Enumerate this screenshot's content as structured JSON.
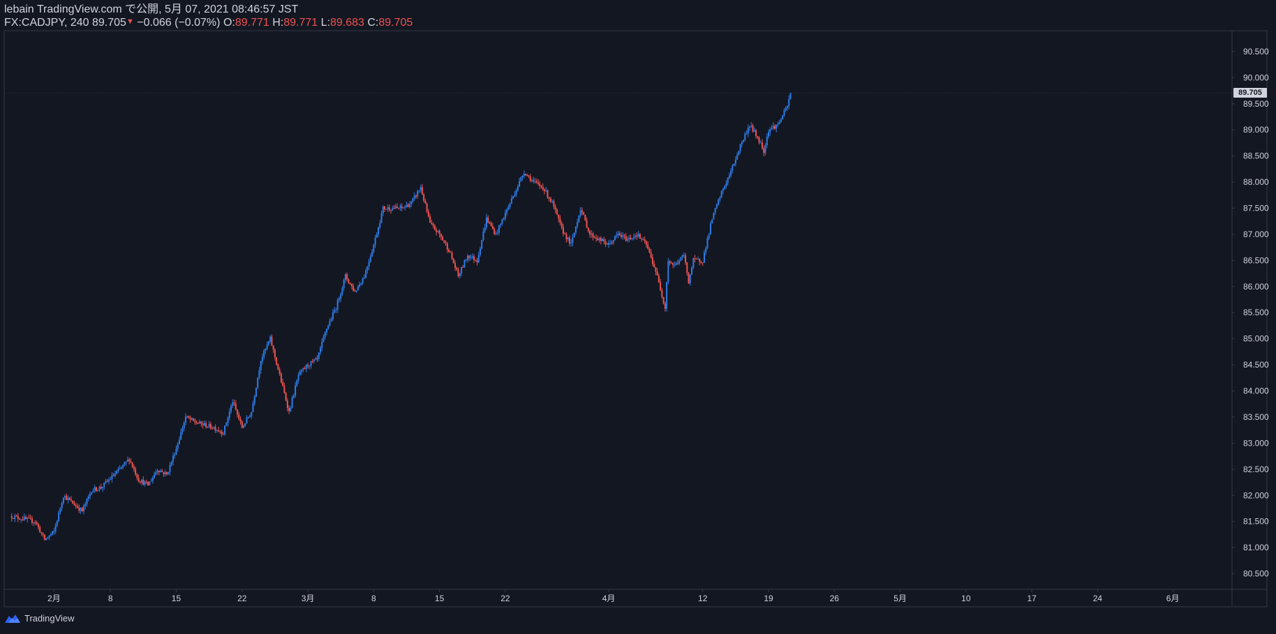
{
  "header": {
    "publish_line": "lebain TradingView.com で公開, 5月 07, 2021 08:46:57 JST",
    "symbol": "FX:CADJPY, 240",
    "last": "89.705",
    "arrow": "▼",
    "change": "−0.066 (−0.07%)",
    "o_label": "O:",
    "o_value": "89.771",
    "h_label": "H:",
    "h_value": "89.771",
    "l_label": "L:",
    "l_value": "89.683",
    "c_label": "C:",
    "c_value": "89.705"
  },
  "last_price_label": "89.705",
  "footer": {
    "brand": "TradingView",
    "logo_icon": "tradingview-logo-icon"
  },
  "colors": {
    "up": "#2f7ce8",
    "down": "#ef5350",
    "bg": "#131722",
    "border": "#363a45",
    "text": "#d1d4dc"
  },
  "chart_data": {
    "type": "candlestick",
    "instrument": "FX:CADJPY",
    "interval": "240",
    "ylim": [
      80.2,
      90.9
    ],
    "y_ticks": [
      "80.500",
      "81.000",
      "81.500",
      "82.000",
      "82.500",
      "83.000",
      "83.500",
      "84.000",
      "84.500",
      "85.000",
      "85.500",
      "86.000",
      "86.500",
      "87.000",
      "87.500",
      "88.000",
      "88.500",
      "89.000",
      "89.500",
      "90.000",
      "90.500"
    ],
    "x_ticks": [
      {
        "label": "2月",
        "day": 2
      },
      {
        "label": "8",
        "day": 8
      },
      {
        "label": "15",
        "day": 15
      },
      {
        "label": "22",
        "day": 22
      },
      {
        "label": "3月",
        "day": 29
      },
      {
        "label": "8",
        "day": 36
      },
      {
        "label": "15",
        "day": 43
      },
      {
        "label": "22",
        "day": 50
      },
      {
        "label": "4月",
        "day": 61
      },
      {
        "label": "12",
        "day": 71
      },
      {
        "label": "19",
        "day": 78
      },
      {
        "label": "26",
        "day": 85
      },
      {
        "label": "5月",
        "day": 92
      },
      {
        "label": "10",
        "day": 99
      },
      {
        "label": "17",
        "day": 106
      },
      {
        "label": "24",
        "day": 113
      },
      {
        "label": "6月",
        "day": 121
      }
    ],
    "path": [
      [
        -2.5,
        81.6
      ],
      [
        0,
        81.5
      ],
      [
        1,
        81.15
      ],
      [
        2,
        81.3
      ],
      [
        3,
        82.0
      ],
      [
        5,
        81.7
      ],
      [
        6,
        82.1
      ],
      [
        7,
        82.15
      ],
      [
        9,
        82.5
      ],
      [
        10,
        82.7
      ],
      [
        11,
        82.3
      ],
      [
        12,
        82.2
      ],
      [
        13,
        82.5
      ],
      [
        14,
        82.4
      ],
      [
        15,
        82.9
      ],
      [
        16,
        83.5
      ],
      [
        17,
        83.4
      ],
      [
        19,
        83.3
      ],
      [
        20,
        83.2
      ],
      [
        21,
        83.8
      ],
      [
        22,
        83.3
      ],
      [
        23,
        83.6
      ],
      [
        24,
        84.6
      ],
      [
        25,
        85.0
      ],
      [
        26,
        84.3
      ],
      [
        27,
        83.6
      ],
      [
        28,
        84.3
      ],
      [
        29,
        84.5
      ],
      [
        30,
        84.6
      ],
      [
        31,
        85.2
      ],
      [
        32,
        85.6
      ],
      [
        33,
        86.2
      ],
      [
        34,
        85.9
      ],
      [
        35,
        86.2
      ],
      [
        36,
        86.8
      ],
      [
        37,
        87.5
      ],
      [
        39,
        87.5
      ],
      [
        40,
        87.6
      ],
      [
        41,
        87.9
      ],
      [
        42,
        87.2
      ],
      [
        43,
        87.0
      ],
      [
        44,
        86.7
      ],
      [
        45,
        86.2
      ],
      [
        46,
        86.6
      ],
      [
        47,
        86.5
      ],
      [
        48,
        87.3
      ],
      [
        49,
        87.0
      ],
      [
        50,
        87.4
      ],
      [
        51,
        87.8
      ],
      [
        52,
        88.2
      ],
      [
        53,
        88.0
      ],
      [
        54,
        87.9
      ],
      [
        55,
        87.6
      ],
      [
        56,
        87.1
      ],
      [
        57,
        86.8
      ],
      [
        58,
        87.5
      ],
      [
        59,
        87.0
      ],
      [
        60,
        86.9
      ],
      [
        61,
        86.8
      ],
      [
        62,
        87.0
      ],
      [
        63,
        86.9
      ],
      [
        64,
        87.0
      ],
      [
        65,
        86.8
      ],
      [
        66,
        86.3
      ],
      [
        67,
        85.6
      ],
      [
        67.3,
        86.5
      ],
      [
        68,
        86.4
      ],
      [
        69,
        86.6
      ],
      [
        69.5,
        86.1
      ],
      [
        70,
        86.5
      ],
      [
        71,
        86.5
      ],
      [
        72,
        87.3
      ],
      [
        73,
        87.8
      ],
      [
        74,
        88.2
      ],
      [
        75,
        88.7
      ],
      [
        76,
        89.1
      ],
      [
        77,
        88.8
      ],
      [
        77.5,
        88.6
      ],
      [
        78,
        89.0
      ],
      [
        79,
        89.1
      ],
      [
        80,
        89.45
      ],
      [
        80.4,
        89.75
      ]
    ]
  }
}
